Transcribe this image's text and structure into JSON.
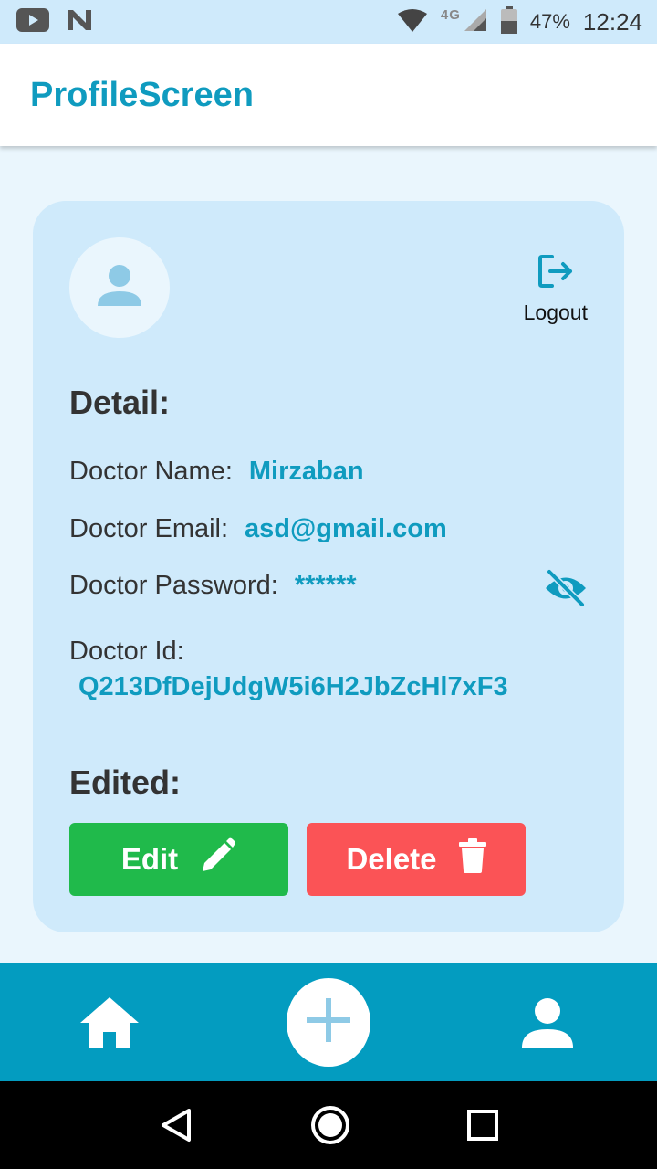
{
  "status_bar": {
    "network": "4G",
    "battery": "47%",
    "time": "12:24",
    "icons": [
      "youtube-icon",
      "n-notification-icon",
      "wifi-icon",
      "signal-icon",
      "battery-icon"
    ]
  },
  "app_bar": {
    "title": "ProfileScreen"
  },
  "card": {
    "logout_label": "Logout",
    "detail_title": "Detail:",
    "doctor_name_label": "Doctor Name:",
    "doctor_name_value": "Mirzaban",
    "doctor_email_label": "Doctor Email:",
    "doctor_email_value": "asd@gmail.com",
    "doctor_password_label": "Doctor Password:",
    "doctor_password_value": "******",
    "doctor_id_label": "Doctor Id:",
    "doctor_id_value": "Q213DfDejUdgW5i6H2JbZcHl7xF3",
    "edited_title": "Edited:",
    "edit_button": "Edit",
    "delete_button": "Delete"
  },
  "bottom_nav": {
    "items": [
      "home-icon",
      "add-icon",
      "profile-icon"
    ]
  },
  "colors": {
    "accent": "#0f9bbf",
    "card_bg": "#cfeafb",
    "page_bg": "#eaf6fd",
    "nav_bg": "#039cc0",
    "edit_green": "#20ba4b",
    "delete_red": "#fb5356"
  }
}
